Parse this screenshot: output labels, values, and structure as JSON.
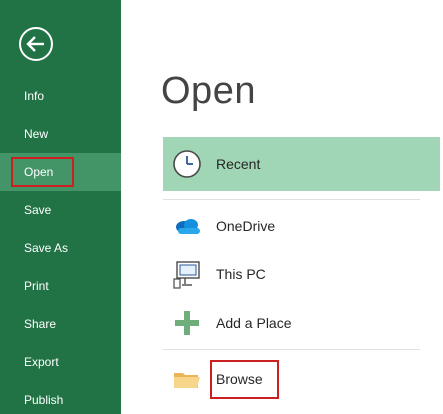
{
  "sidebar": {
    "background": "#217346",
    "active_background": "#439467",
    "back_icon": "back-arrow-icon",
    "items": [
      {
        "label": "Info"
      },
      {
        "label": "New"
      },
      {
        "label": "Open",
        "active": true,
        "highlighted": true
      },
      {
        "label": "Save"
      },
      {
        "label": "Save As"
      },
      {
        "label": "Print"
      },
      {
        "label": "Share"
      },
      {
        "label": "Export"
      },
      {
        "label": "Publish"
      }
    ]
  },
  "main": {
    "title": "Open",
    "locations": [
      {
        "label": "Recent",
        "icon": "clock-icon",
        "selected": true
      },
      {
        "label": "OneDrive",
        "icon": "onedrive-cloud-icon"
      },
      {
        "label": "This PC",
        "icon": "computer-icon"
      },
      {
        "label": "Add a Place",
        "icon": "plus-icon"
      },
      {
        "label": "Browse",
        "icon": "folder-icon",
        "highlighted": true
      }
    ]
  },
  "colors": {
    "selected_row": "#a0d5b5",
    "highlight_box": "#cc1f1f",
    "accent_green": "#217346",
    "onedrive_blue": "#0f6cbd"
  }
}
